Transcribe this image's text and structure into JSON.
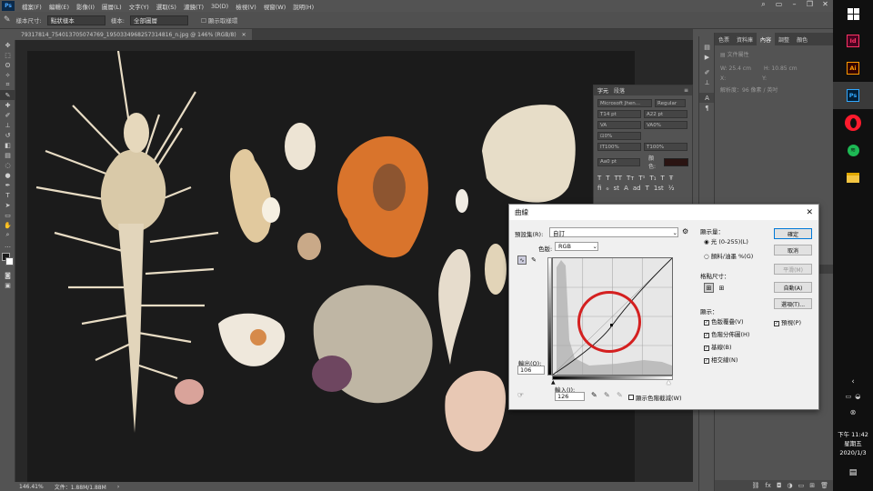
{
  "app": {
    "logo": "Ps",
    "menu": [
      "檔案(F)",
      "編輯(E)",
      "影像(I)",
      "圖層(L)",
      "文字(Y)",
      "選取(S)",
      "濾鏡(T)",
      "3D(D)",
      "檢視(V)",
      "視窗(W)",
      "說明(H)"
    ]
  },
  "options_bar": {
    "sample_size_label": "樣本尺寸:",
    "sample_size_value": "點狀樣本",
    "sample_label": "樣本:",
    "sample_value": "全部圖層",
    "show_ring": "顯示取樣環"
  },
  "document": {
    "tab_title": "79317814_754013705074769_1950334968257314816_n.jpg @ 146% (RGB/8)",
    "zoom": "146.41%",
    "file_info": "文件：1.88M/1.88M"
  },
  "right_panel": {
    "tabs": [
      "色票",
      "資料庫",
      "內容",
      "調整",
      "顏色"
    ],
    "active_tab": "內容",
    "section": "文件屬性",
    "w_label": "W:",
    "w_value": "25.4 cm",
    "h_label": "H:",
    "h_value": "10.85 cm",
    "x_label": "X:",
    "y_label": "Y:",
    "resolution": "解析度：96 像素 / 英吋"
  },
  "char_panel": {
    "tabs": [
      "字元",
      "段落"
    ],
    "font": "Microsoft Jhen...",
    "style": "Regular",
    "size": "14 pt",
    "leading": "22 pt",
    "tracking": "0%",
    "scale_v": "100%",
    "scale_h": "100%",
    "baseline": "0 pt",
    "color_label": "顏色:"
  },
  "curves": {
    "title": "曲線",
    "preset_label": "預設集(R):",
    "preset_value": "自訂",
    "channel_label": "色版:",
    "channel_value": "RGB",
    "output_label": "輸出(O):",
    "output_value": "106",
    "input_label": "輸入(I):",
    "input_value": "126",
    "show_clipping": "顯示色階截減(W)",
    "display_amount_label": "顯示量：",
    "light_option": "光 (0-255)(L)",
    "pigment_option": "顏料/油墨 %(G)",
    "grid_size_label": "格點尺寸：",
    "options_label": "顯示：",
    "chk_channel_overlay": "色版覆疊(V)",
    "chk_histogram": "色階分佈圖(H)",
    "chk_baseline": "基線(B)",
    "chk_intersection": "相交線(N)",
    "btn_ok": "確定",
    "btn_cancel": "取消",
    "btn_smooth": "平滑(M)",
    "btn_auto": "自動(A)",
    "btn_options": "選項(T)...",
    "preview_label": "預視(P)",
    "annotation_color": "#d42020"
  },
  "taskbar": {
    "time": "下午 11:42",
    "weekday": "星期五",
    "date": "2020/1/3",
    "apps": [
      "Id",
      "Ai",
      "Ps",
      "Opera",
      "Spotify",
      "Explorer"
    ]
  }
}
